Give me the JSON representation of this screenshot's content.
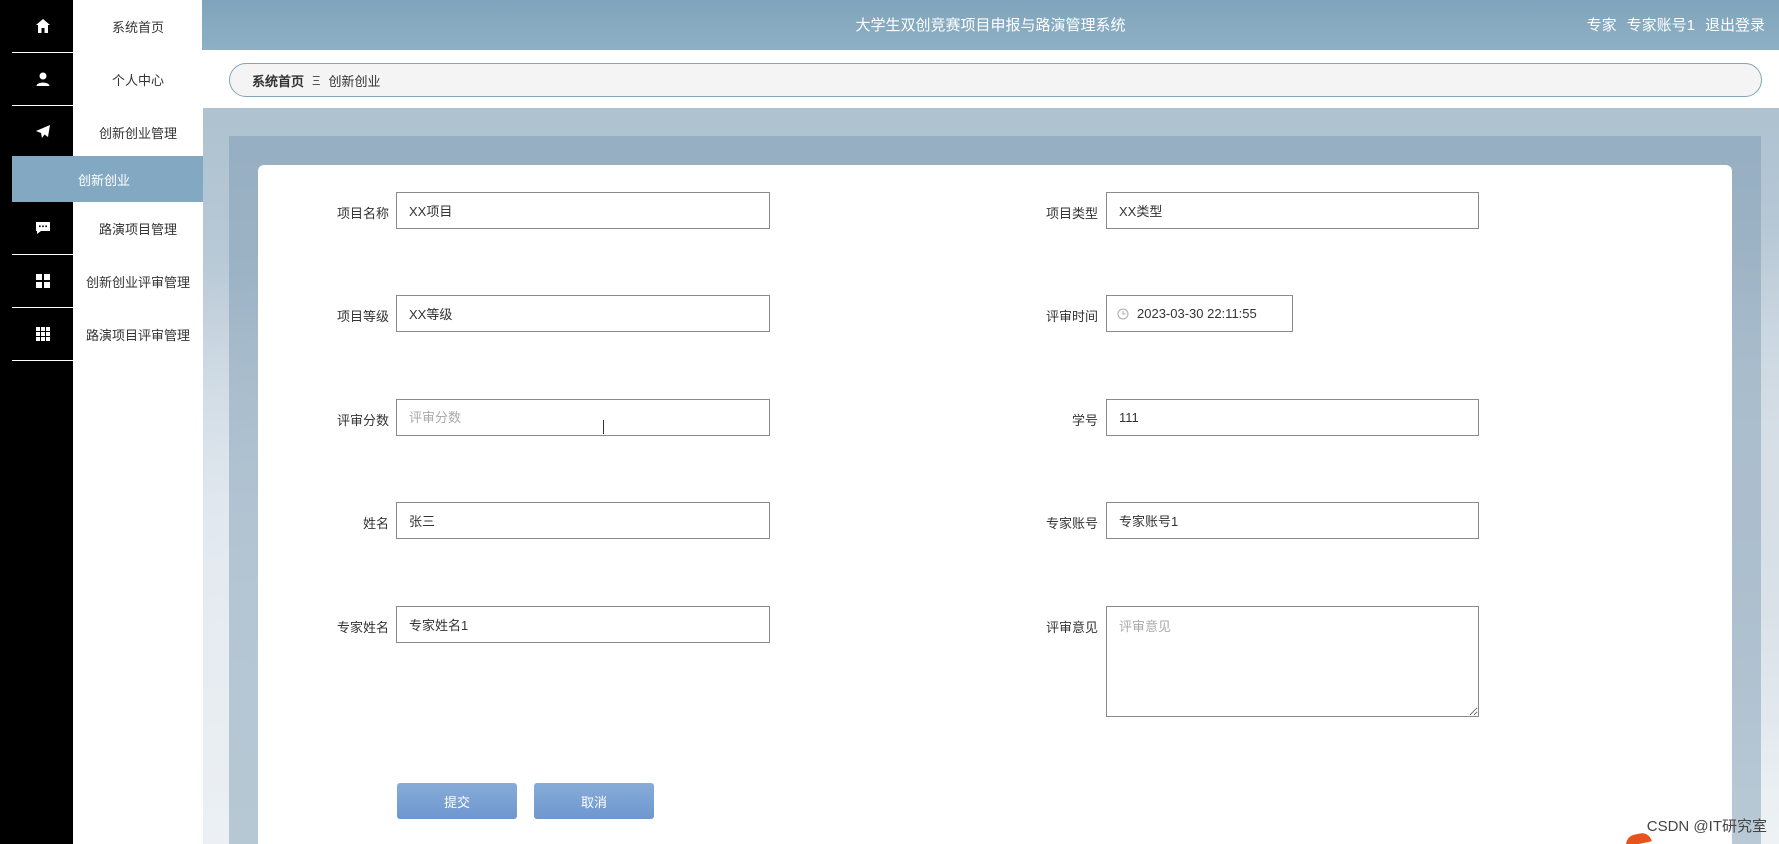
{
  "header": {
    "title": "大学生双创竞赛项目申报与路演管理系统",
    "role": "专家",
    "account": "专家账号1",
    "logout_label": "退出登录"
  },
  "menu": {
    "items": [
      {
        "label": "系统首页",
        "icon": "home-icon"
      },
      {
        "label": "个人中心",
        "icon": "user-icon"
      },
      {
        "label": "创新创业管理",
        "icon": "send-icon"
      },
      {
        "label": "创新创业",
        "icon": ""
      },
      {
        "label": "路演项目管理",
        "icon": "chat-icon"
      },
      {
        "label": "创新创业评审管理",
        "icon": "grid-icon"
      },
      {
        "label": "路演项目评审管理",
        "icon": "apps-icon"
      }
    ],
    "active_label": "创新创业"
  },
  "breadcrumb": {
    "home": "系统首页",
    "separator": "Ξ",
    "current": "创新创业"
  },
  "form": {
    "project_name": {
      "label": "项目名称",
      "value": "XX项目"
    },
    "project_type": {
      "label": "项目类型",
      "value": "XX类型"
    },
    "project_level": {
      "label": "项目等级",
      "value": "XX等级"
    },
    "review_time": {
      "label": "评审时间",
      "value": "2023-03-30 22:11:55"
    },
    "review_score": {
      "label": "评审分数",
      "value": "",
      "placeholder": "评审分数"
    },
    "student_id": {
      "label": "学号",
      "value": "111"
    },
    "name": {
      "label": "姓名",
      "value": "张三"
    },
    "expert_account": {
      "label": "专家账号",
      "value": "专家账号1"
    },
    "expert_name": {
      "label": "专家姓名",
      "value": "专家姓名1"
    },
    "review_opinion": {
      "label": "评审意见",
      "value": "",
      "placeholder": "评审意见"
    },
    "submit_label": "提交",
    "cancel_label": "取消"
  },
  "watermark": "CSDN @IT研究室",
  "colors": {
    "header": "#7fa4bb",
    "active_menu": "#83a8c2",
    "button": "#7ba1d3",
    "rail": "#000000"
  }
}
